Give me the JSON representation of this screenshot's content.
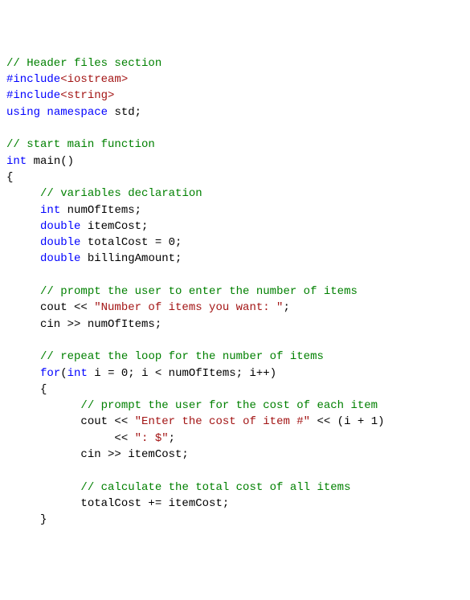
{
  "colors": {
    "comment": "#008000",
    "keyword": "#0000ff",
    "include": "#a31515",
    "string": "#a31515",
    "number": "#000000",
    "default": "#000000"
  },
  "code": [
    [
      {
        "t": "// Header files section",
        "c": "comment"
      }
    ],
    [
      {
        "t": "#include",
        "c": "keyword"
      },
      {
        "t": "<iostream>",
        "c": "include"
      }
    ],
    [
      {
        "t": "#include",
        "c": "keyword"
      },
      {
        "t": "<string>",
        "c": "include"
      }
    ],
    [
      {
        "t": "using",
        "c": "keyword"
      },
      {
        "t": " ",
        "c": "default"
      },
      {
        "t": "namespace",
        "c": "keyword"
      },
      {
        "t": " std;",
        "c": "default"
      }
    ],
    [
      {
        "t": "",
        "c": "default"
      }
    ],
    [
      {
        "t": "// start main function",
        "c": "comment"
      }
    ],
    [
      {
        "t": "int",
        "c": "keyword"
      },
      {
        "t": " main()",
        "c": "default"
      }
    ],
    [
      {
        "t": "{",
        "c": "default"
      }
    ],
    [
      {
        "t": "     ",
        "c": "default"
      },
      {
        "t": "// variables declaration",
        "c": "comment"
      }
    ],
    [
      {
        "t": "     ",
        "c": "default"
      },
      {
        "t": "int",
        "c": "keyword"
      },
      {
        "t": " numOfItems;",
        "c": "default"
      }
    ],
    [
      {
        "t": "     ",
        "c": "default"
      },
      {
        "t": "double",
        "c": "keyword"
      },
      {
        "t": " itemCost;",
        "c": "default"
      }
    ],
    [
      {
        "t": "     ",
        "c": "default"
      },
      {
        "t": "double",
        "c": "keyword"
      },
      {
        "t": " totalCost = 0;",
        "c": "default"
      }
    ],
    [
      {
        "t": "     ",
        "c": "default"
      },
      {
        "t": "double",
        "c": "keyword"
      },
      {
        "t": " billingAmount;",
        "c": "default"
      }
    ],
    [
      {
        "t": "",
        "c": "default"
      }
    ],
    [
      {
        "t": "     ",
        "c": "default"
      },
      {
        "t": "// prompt the user to enter the number of items",
        "c": "comment"
      }
    ],
    [
      {
        "t": "     cout << ",
        "c": "default"
      },
      {
        "t": "\"Number of items you want: \"",
        "c": "string"
      },
      {
        "t": ";",
        "c": "default"
      }
    ],
    [
      {
        "t": "     cin >> numOfItems;",
        "c": "default"
      }
    ],
    [
      {
        "t": "",
        "c": "default"
      }
    ],
    [
      {
        "t": "     ",
        "c": "default"
      },
      {
        "t": "// repeat the loop for the number of items",
        "c": "comment"
      }
    ],
    [
      {
        "t": "     ",
        "c": "default"
      },
      {
        "t": "for",
        "c": "keyword"
      },
      {
        "t": "(",
        "c": "default"
      },
      {
        "t": "int",
        "c": "keyword"
      },
      {
        "t": " i = 0; i < numOfItems; i++)",
        "c": "default"
      }
    ],
    [
      {
        "t": "     {",
        "c": "default"
      }
    ],
    [
      {
        "t": "           ",
        "c": "default"
      },
      {
        "t": "// prompt the user for the cost of each item",
        "c": "comment"
      }
    ],
    [
      {
        "t": "           cout << ",
        "c": "default"
      },
      {
        "t": "\"Enter the cost of item #\"",
        "c": "string"
      },
      {
        "t": " << (i + 1)",
        "c": "default"
      }
    ],
    [
      {
        "t": "                << ",
        "c": "default"
      },
      {
        "t": "\": $\"",
        "c": "string"
      },
      {
        "t": ";",
        "c": "default"
      }
    ],
    [
      {
        "t": "           cin >> itemCost;",
        "c": "default"
      }
    ],
    [
      {
        "t": "",
        "c": "default"
      }
    ],
    [
      {
        "t": "           ",
        "c": "default"
      },
      {
        "t": "// calculate the total cost of all items",
        "c": "comment"
      }
    ],
    [
      {
        "t": "           totalCost += itemCost;",
        "c": "default"
      }
    ],
    [
      {
        "t": "     }",
        "c": "default"
      }
    ]
  ]
}
